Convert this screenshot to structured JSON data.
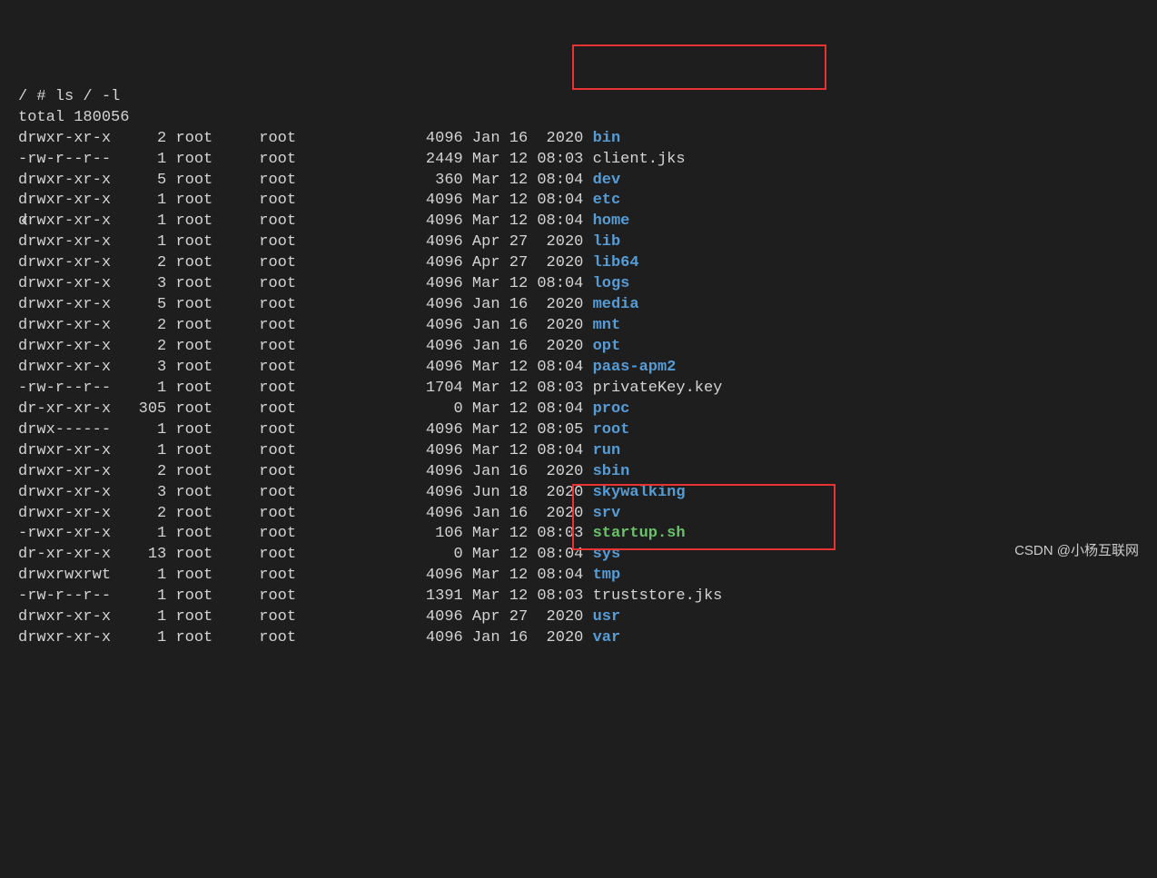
{
  "prompt": "/ # ls / -l",
  "total": "total 180056",
  "rows": [
    {
      "perm": "drwxr-xr-x",
      "links": "2",
      "owner": "root",
      "group": "root",
      "size": "4096",
      "date": "Jan 16  2020",
      "name": "bin",
      "cls": "dir-link"
    },
    {
      "perm": "-rw-r--r--",
      "links": "1",
      "owner": "root",
      "group": "root",
      "size": "2449",
      "date": "Mar 12 08:03",
      "name": "client.jks",
      "cls": "plain"
    },
    {
      "perm": "drwxr-xr-x",
      "links": "5",
      "owner": "root",
      "group": "root",
      "size": "360",
      "date": "Mar 12 08:04",
      "name": "dev",
      "cls": "dir-link"
    },
    {
      "perm": "drwxr-xr-x",
      "links": "1",
      "owner": "root",
      "group": "root",
      "size": "4096",
      "date": "Mar 12 08:04",
      "name": "etc",
      "cls": "dir-link"
    },
    {
      "perm": "drwxr-xr-x",
      "links": "1",
      "owner": "root",
      "group": "root",
      "size": "4096",
      "date": "Mar 12 08:04",
      "name": "home",
      "cls": "dir-link"
    },
    {
      "perm": "drwxr-xr-x",
      "links": "1",
      "owner": "root",
      "group": "root",
      "size": "4096",
      "date": "Apr 27  2020",
      "name": "lib",
      "cls": "dir-link"
    },
    {
      "perm": "drwxr-xr-x",
      "links": "2",
      "owner": "root",
      "group": "root",
      "size": "4096",
      "date": "Apr 27  2020",
      "name": "lib64",
      "cls": "dir-link"
    },
    {
      "perm": "drwxr-xr-x",
      "links": "3",
      "owner": "root",
      "group": "root",
      "size": "4096",
      "date": "Mar 12 08:04",
      "name": "logs",
      "cls": "dir-link"
    },
    {
      "perm": "drwxr-xr-x",
      "links": "5",
      "owner": "root",
      "group": "root",
      "size": "4096",
      "date": "Jan 16  2020",
      "name": "media",
      "cls": "dir-link"
    },
    {
      "perm": "drwxr-xr-x",
      "links": "2",
      "owner": "root",
      "group": "root",
      "size": "4096",
      "date": "Jan 16  2020",
      "name": "mnt",
      "cls": "dir-link"
    },
    {
      "perm": "drwxr-xr-x",
      "links": "2",
      "owner": "root",
      "group": "root",
      "size": "4096",
      "date": "Jan 16  2020",
      "name": "opt",
      "cls": "dir-link"
    },
    {
      "perm": "drwxr-xr-x",
      "links": "3",
      "owner": "root",
      "group": "root",
      "size": "4096",
      "date": "Mar 12 08:04",
      "name": "paas-apm2",
      "cls": "dir-link"
    },
    {
      "perm": "-rw-r--r--",
      "links": "1",
      "owner": "root",
      "group": "root",
      "size": "1704",
      "date": "Mar 12 08:03",
      "name": "privateKey.key",
      "cls": "plain"
    },
    {
      "perm": "dr-xr-xr-x",
      "links": "305",
      "owner": "root",
      "group": "root",
      "size": "0",
      "date": "Mar 12 08:04",
      "name": "proc",
      "cls": "dir-link"
    },
    {
      "perm": "drwx------",
      "links": "1",
      "owner": "root",
      "group": "root",
      "size": "4096",
      "date": "Mar 12 08:05",
      "name": "root",
      "cls": "dir-link"
    },
    {
      "perm": "drwxr-xr-x",
      "links": "1",
      "owner": "root",
      "group": "root",
      "size": "4096",
      "date": "Mar 12 08:04",
      "name": "run",
      "cls": "dir-link"
    },
    {
      "perm": "drwxr-xr-x",
      "links": "2",
      "owner": "root",
      "group": "root",
      "size": "4096",
      "date": "Jan 16  2020",
      "name": "sbin",
      "cls": "dir-link"
    },
    {
      "perm": "drwxr-xr-x",
      "links": "3",
      "owner": "root",
      "group": "root",
      "size": "4096",
      "date": "Jun 18  2020",
      "name": "skywalking",
      "cls": "dir-link"
    },
    {
      "perm": "drwxr-xr-x",
      "links": "2",
      "owner": "root",
      "group": "root",
      "size": "4096",
      "date": "Jan 16  2020",
      "name": "srv",
      "cls": "dir-link"
    },
    {
      "perm": "-rwxr-xr-x",
      "links": "1",
      "owner": "root",
      "group": "root",
      "size": "106",
      "date": "Mar 12 08:03",
      "name": "startup.sh",
      "cls": "exec"
    },
    {
      "perm": "dr-xr-xr-x",
      "links": "13",
      "owner": "root",
      "group": "root",
      "size": "0",
      "date": "Mar 12 08:04",
      "name": "sys",
      "cls": "dir-link"
    },
    {
      "perm": "drwxrwxrwt",
      "links": "1",
      "owner": "root",
      "group": "root",
      "size": "4096",
      "date": "Mar 12 08:04",
      "name": "tmp",
      "cls": "dir-link"
    },
    {
      "perm": "-rw-r--r--",
      "links": "1",
      "owner": "root",
      "group": "root",
      "size": "1391",
      "date": "Mar 12 08:03",
      "name": "truststore.jks",
      "cls": "plain"
    },
    {
      "perm": "drwxr-xr-x",
      "links": "1",
      "owner": "root",
      "group": "root",
      "size": "4096",
      "date": "Apr 27  2020",
      "name": "usr",
      "cls": "dir-link"
    },
    {
      "perm": "drwxr-xr-x",
      "links": "1",
      "owner": "root",
      "group": "root",
      "size": "4096",
      "date": "Jan 16  2020",
      "name": "var",
      "cls": "dir-link"
    }
  ],
  "chevron": "‹",
  "watermark": "CSDN @小杨互联网"
}
